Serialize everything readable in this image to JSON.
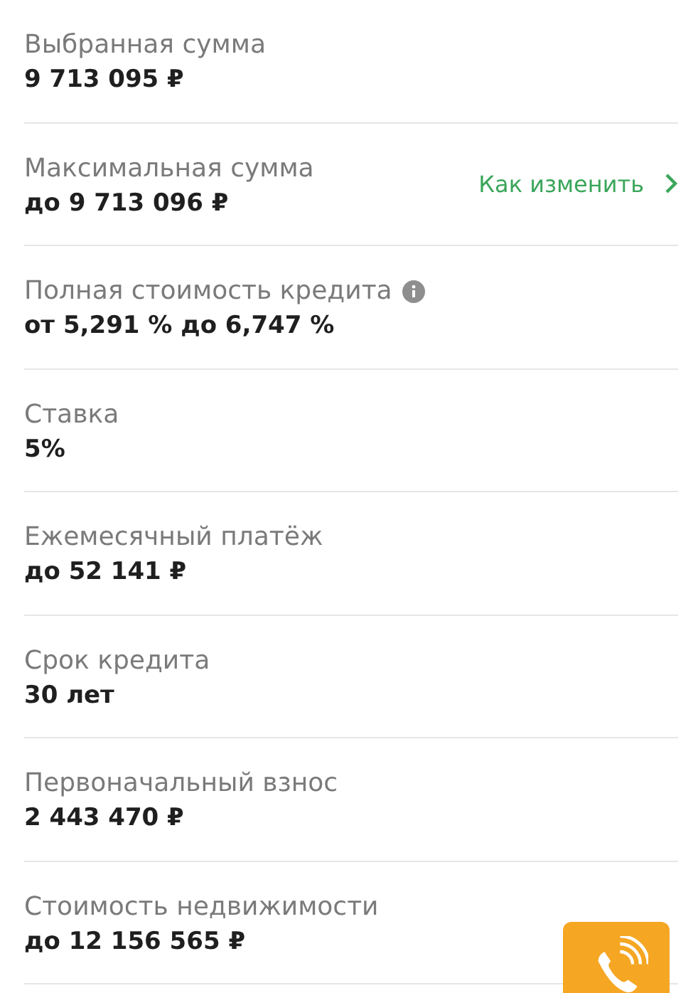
{
  "rows": [
    {
      "label": "Выбранная сумма",
      "value": "9 713 095 ₽"
    },
    {
      "label": "Максимальная сумма",
      "value": "до 9 713 096 ₽",
      "link": "Как изменить"
    },
    {
      "label": "Полная стоимость кредита",
      "value": "от 5,291 % до 6,747 %",
      "info": true
    },
    {
      "label": "Ставка",
      "value": "5%"
    },
    {
      "label": "Ежемесячный платёж",
      "value": "до 52 141 ₽"
    },
    {
      "label": "Срок кредита",
      "value": "30 лет"
    },
    {
      "label": "Первоначальный взнос",
      "value": "2 443 470 ₽"
    },
    {
      "label": "Стоимость недвижимости",
      "value": "до 12 156 565 ₽"
    }
  ]
}
